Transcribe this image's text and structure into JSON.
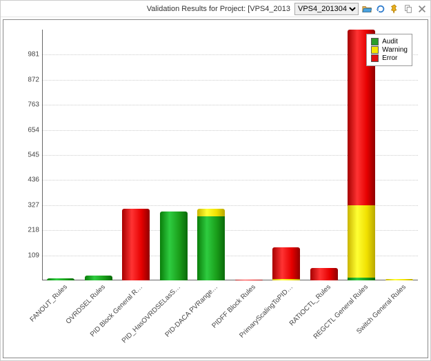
{
  "titlebar": {
    "title_prefix": "Validation Results for Project: [VPS4_2013",
    "project_selected": "VPS4_201304",
    "project_options": [
      "VPS4_201304"
    ]
  },
  "icons": {
    "open": "folder-open-icon",
    "refresh": "refresh-icon",
    "pin": "pin-icon",
    "copy": "copy-icon",
    "close": "close-icon"
  },
  "legend": {
    "audit": "Audit",
    "warning": "Warning",
    "error": "Error"
  },
  "chart_data": {
    "type": "bar",
    "stacked": true,
    "ylim": [
      0,
      1090
    ],
    "yticks": [
      109,
      218,
      327,
      436,
      545,
      654,
      763,
      872,
      981
    ],
    "categories": [
      "FANOUT_Rules",
      "OVRDSEL Rules",
      "PID Block General R…",
      "PID_HasOVRDSELasS…",
      "PID-DACA PVRange…",
      "PIDFF Block Rules",
      "PrimaryScalingToPID…",
      "RATIOCTL_Rules",
      "REGCTL General Rules",
      "Switch General Rules"
    ],
    "series": [
      {
        "name": "Audit",
        "color": "#2a9d2a",
        "values": [
          10,
          22,
          0,
          300,
          280,
          0,
          0,
          0,
          12,
          0
        ]
      },
      {
        "name": "Warning",
        "color": "#f5e500",
        "values": [
          0,
          0,
          0,
          0,
          30,
          0,
          5,
          0,
          315,
          7
        ]
      },
      {
        "name": "Error",
        "color": "#e01010",
        "values": [
          0,
          0,
          310,
          0,
          0,
          3,
          140,
          55,
          763,
          0
        ]
      }
    ],
    "xlabel": "",
    "ylabel": "",
    "legend_position": "top-right",
    "grid": true
  }
}
